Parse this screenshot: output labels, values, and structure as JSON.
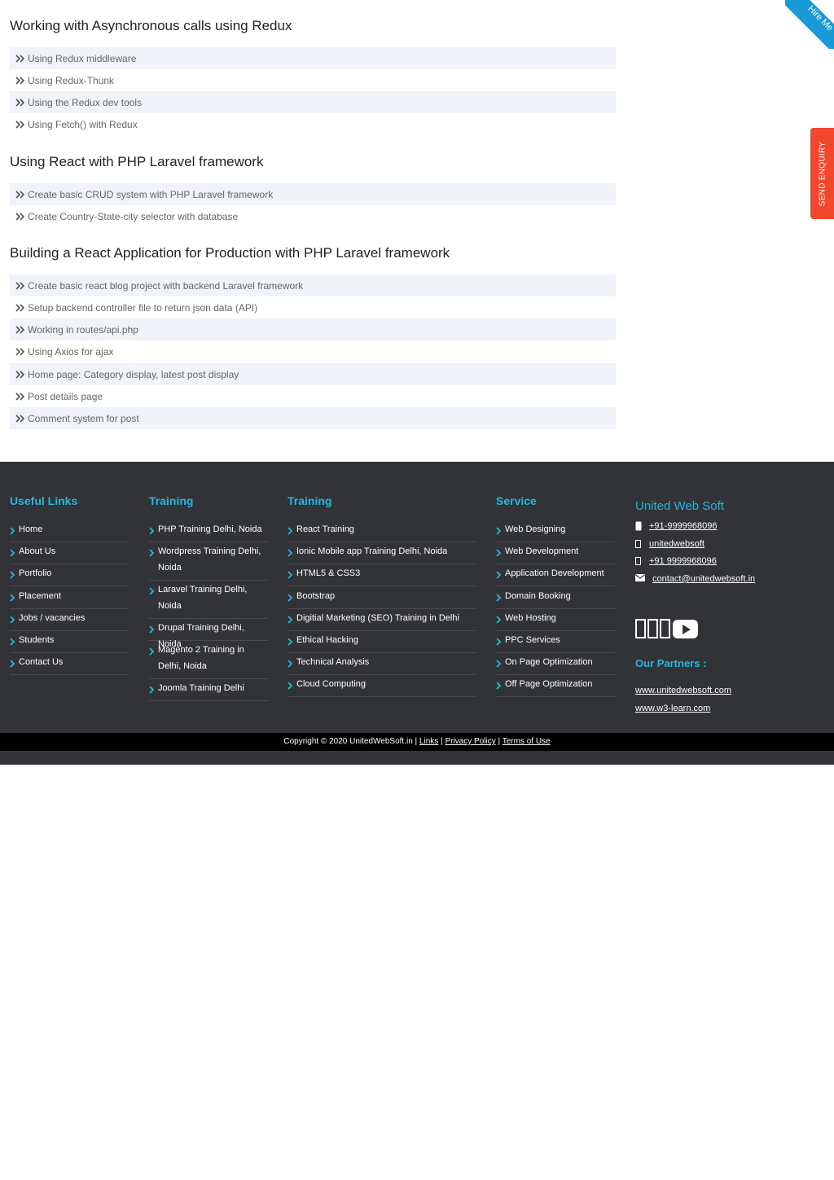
{
  "ribbon": {
    "label": "Hire Me"
  },
  "enquiry": {
    "label": "SEND ENQUIRY"
  },
  "sections": [
    {
      "title": "Working with Asynchronous calls using Redux",
      "topics": [
        "Using Redux middleware",
        "Using Redux-Thunk",
        "Using the Redux dev tools",
        "Using Fetch() with Redux"
      ]
    },
    {
      "title": "Using React with PHP Laravel framework",
      "topics": [
        "Create basic CRUD system with PHP Laravel framework",
        "Create Country-State-city selector with database"
      ]
    },
    {
      "title": "Building a React Application for Production with PHP Laravel framework",
      "topics": [
        "Create basic react blog project with backend Laravel framework",
        "Setup backend controller file to return json data (API)",
        "Working in routes/api.php",
        "Using Axios for ajax",
        "Home page: Category display, latest post display",
        "Post details page",
        "Comment system for post"
      ]
    }
  ],
  "footer": {
    "useful_links": {
      "title": "Useful Links",
      "items": [
        "Home",
        "About Us",
        "Portfolio",
        "Placement",
        "Jobs / vacancies",
        "Students",
        "Contact Us"
      ]
    },
    "training1": {
      "title": "Training",
      "items": [
        "PHP Training Delhi, Noida",
        "Wordpress Training Delhi, Noida",
        "Laravel Training Delhi, Noida",
        "Drupal Training Delhi, Noida",
        "Magento 2 Training in Delhi, Noida",
        "Joomla Training Delhi"
      ]
    },
    "training2": {
      "title": "Training",
      "items": [
        "React Training",
        "Ionic Mobile app Training Delhi, Noida",
        "HTML5 & CSS3",
        "Bootstrap",
        "Digitial Marketing (SEO) Training in Delhi",
        "Ethical Hacking",
        "Technical Analysis",
        "Cloud Computing"
      ]
    },
    "service": {
      "title": "Service",
      "items": [
        "Web Designing",
        "Web Development",
        "Application Development",
        "Domain Booking",
        "Web Hosting",
        "PPC Services",
        "On Page Optimization",
        "Off Page Optimization"
      ]
    },
    "company": {
      "title": "United Web Soft",
      "contacts": [
        "+91-9999968096",
        "unitedwebsoft",
        "+91 9999968096",
        "contact@unitedwebsoft.in"
      ],
      "partners_title": "Our Partners :",
      "partners": [
        "www.unitedwebsoft.com",
        "www.w3-learn.com"
      ]
    },
    "copyright": {
      "text": "Copyright © 2020 UnitedWebSoft.in |",
      "links": "Links",
      "privacy": "Privacy Policy",
      "terms": "Terms of Use"
    }
  },
  "colors": {
    "accent": "#27b6e0",
    "footer_bg": "#323337",
    "ribbon": "#1a9ad6",
    "enquiry": "#f3472d"
  }
}
